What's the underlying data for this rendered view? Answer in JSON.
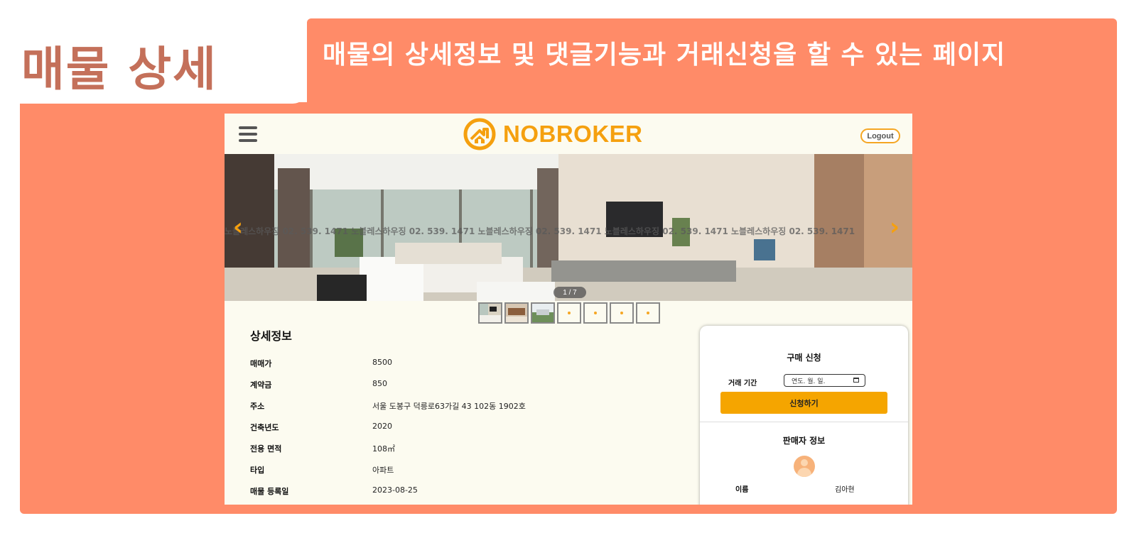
{
  "slide": {
    "title": "매물 상세",
    "description": "매물의 상세정보 및 댓글기능과 거래신청을 할 수 있는 페이지",
    "accent_color": "#FF8B68",
    "title_color": "#C4705A"
  },
  "header": {
    "logo_text": "NOBROKER",
    "logout_label": "Logout",
    "brand_color": "#F5A00F"
  },
  "gallery": {
    "watermark": "노블레스하우징 02. 539. 1471        노블레스하우징 02. 539. 1471        노블레스하우징 02. 539. 1471        노블레스하우징 02. 539. 1471        노블레스하우징 02. 539. 1471",
    "counter": "1 / 7",
    "prev_icon": "‹",
    "next_icon": "›"
  },
  "details": {
    "title": "상세정보",
    "rows": [
      {
        "label": "매매가",
        "value": "8500"
      },
      {
        "label": "계약금",
        "value": "850"
      },
      {
        "label": "주소",
        "value": "서울 도봉구 덕릉로63가길 43 102동 1902호"
      },
      {
        "label": "건축년도",
        "value": "2020"
      },
      {
        "label": "전용 면적",
        "value": "108㎡"
      },
      {
        "label": "타입",
        "value": "아파트"
      },
      {
        "label": "매물 등록일",
        "value": "2023-08-25"
      }
    ]
  },
  "purchase": {
    "title": "구매 신청",
    "period_label": "거래 기간",
    "date_placeholder": "연도. 월. 일.",
    "apply_label": "신청하기"
  },
  "seller": {
    "title": "판매자 정보",
    "name_label": "이름",
    "name_value": "김아현"
  }
}
